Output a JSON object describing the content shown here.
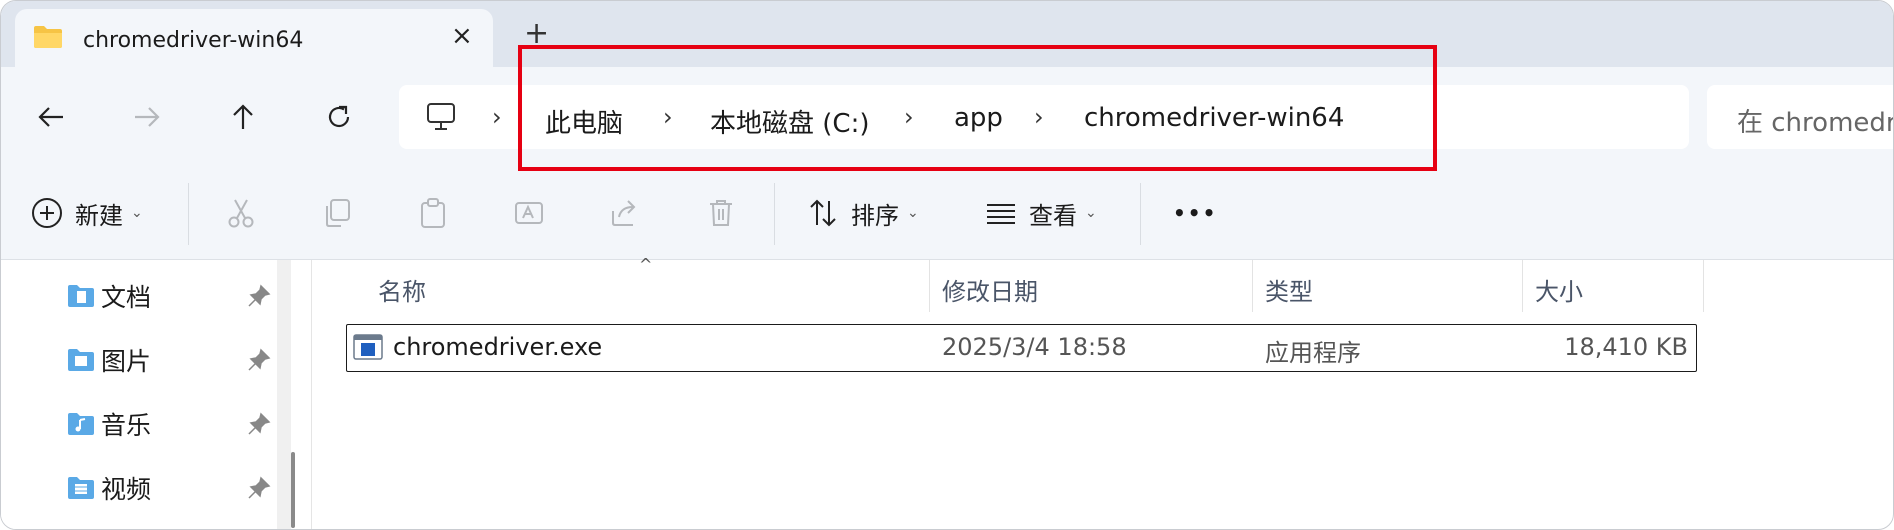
{
  "tab": {
    "title": "chromedriver-win64",
    "close_icon": "×",
    "new_tab_icon": "+"
  },
  "nav": {
    "back": "back-arrow-icon",
    "forward": "forward-arrow-icon",
    "up": "up-arrow-icon",
    "refresh": "refresh-icon"
  },
  "address": {
    "crumbs": [
      "此电脑",
      "本地磁盘 (C:)",
      "app",
      "chromedriver-win64"
    ],
    "separator": "›"
  },
  "search": {
    "placeholder": "在 chromedr"
  },
  "commands": {
    "new_label": "新建",
    "sort_label": "排序",
    "view_label": "查看",
    "more": "•••"
  },
  "sidebar": {
    "items": [
      {
        "label": "文档"
      },
      {
        "label": "图片"
      },
      {
        "label": "音乐"
      },
      {
        "label": "视频"
      }
    ]
  },
  "columns": {
    "name": "名称",
    "modified": "修改日期",
    "type": "类型",
    "size": "大小"
  },
  "files": [
    {
      "name": "chromedriver.exe",
      "modified": "2025/3/4 18:58",
      "type": "应用程序",
      "size": "18,410 KB"
    }
  ],
  "colors": {
    "highlight_box": "#e60012",
    "folder": "#f6c445",
    "libfolder": "#5aa9e6"
  }
}
